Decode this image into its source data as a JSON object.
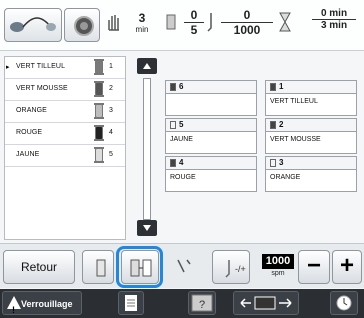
{
  "topbar": {
    "stitch_count": {
      "value": "3",
      "unit": "min"
    },
    "color_progress": {
      "numerator": "0",
      "denominator": "5"
    },
    "stitch_progress": {
      "numerator": "0",
      "denominator": "1000"
    },
    "time_progress": {
      "numerator": "0 min",
      "denominator": "3 min"
    }
  },
  "thread_list": [
    {
      "marker": "▸",
      "label": "VERT TILLEUL",
      "num": "1",
      "spool_color": "#7a7a7a"
    },
    {
      "marker": "",
      "label": "VERT MOUSSE",
      "num": "2",
      "spool_color": "#555555"
    },
    {
      "marker": "",
      "label": "ORANGE",
      "num": "3",
      "spool_color": "#bdbdbd"
    },
    {
      "marker": "",
      "label": "ROUGE",
      "num": "4",
      "spool_color": "#222222"
    },
    {
      "marker": "",
      "label": "JAUNE",
      "num": "5",
      "spool_color": "#dddddd"
    }
  ],
  "grid": {
    "cells": [
      {
        "num": "6",
        "name": "",
        "dark": true
      },
      {
        "num": "1",
        "name": "VERT TILLEUL",
        "dark": true
      },
      {
        "num": "5",
        "name": "JAUNE",
        "dark": false
      },
      {
        "num": "2",
        "name": "VERT MOUSSE",
        "dark": true
      },
      {
        "num": "4",
        "name": "ROUGE",
        "dark": true
      },
      {
        "num": "3",
        "name": "ORANGE",
        "dark": false
      }
    ]
  },
  "bottom": {
    "retour_label": "Retour",
    "speed_value": "1000",
    "speed_unit": "spm",
    "minus": "−",
    "plus": "+"
  },
  "strip": {
    "lock_label": "Verrouillage"
  },
  "colors": {
    "highlight": "#1e88e5"
  }
}
